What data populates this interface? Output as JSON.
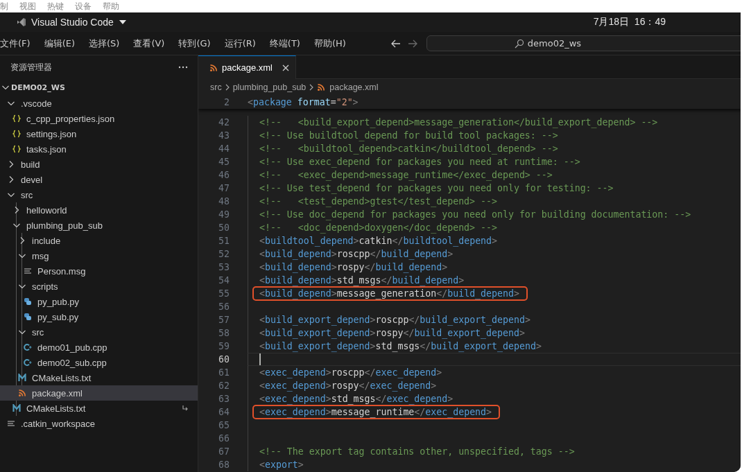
{
  "system_menu": [
    "制",
    "视图",
    "热键",
    "设备",
    "帮助"
  ],
  "title_bar": {
    "app_title": "Visual Studio Code",
    "clock": "7月18日  16：49"
  },
  "menu_bar": [
    "文件(F)",
    "编辑(E)",
    "选择(S)",
    "查看(V)",
    "转到(G)",
    "运行(R)",
    "终端(T)",
    "帮助(H)"
  ],
  "navigation": {
    "back_disabled": false,
    "forward_disabled": true
  },
  "command_center": {
    "label": "demo02_ws"
  },
  "explorer": {
    "title": "资源管理器",
    "workspace": "DEMO02_WS",
    "expanded": true,
    "items": [
      {
        "name": ".vscode",
        "kind": "folder",
        "expanded": true,
        "selected": false,
        "children": [
          {
            "name": "c_cpp_properties.json",
            "kind": "json",
            "selected": false,
            "symlink": false
          },
          {
            "name": "settings.json",
            "kind": "json",
            "selected": false,
            "symlink": false
          },
          {
            "name": "tasks.json",
            "kind": "json",
            "selected": false,
            "symlink": false
          }
        ]
      },
      {
        "name": "build",
        "kind": "folder",
        "expanded": false,
        "selected": false
      },
      {
        "name": "devel",
        "kind": "folder",
        "expanded": false,
        "selected": false
      },
      {
        "name": "src",
        "kind": "folder",
        "expanded": true,
        "selected": false,
        "children": [
          {
            "name": "helloworld",
            "kind": "folder",
            "expanded": false,
            "selected": false
          },
          {
            "name": "plumbing_pub_sub",
            "kind": "folder",
            "expanded": true,
            "selected": false,
            "children": [
              {
                "name": "include",
                "kind": "folder",
                "expanded": false,
                "selected": false
              },
              {
                "name": "msg",
                "kind": "folder",
                "expanded": true,
                "selected": false,
                "children": [
                  {
                    "name": "Person.msg",
                    "kind": "text",
                    "selected": false,
                    "symlink": false
                  }
                ]
              },
              {
                "name": "scripts",
                "kind": "folder",
                "expanded": true,
                "selected": false,
                "children": [
                  {
                    "name": "py_pub.py",
                    "kind": "python",
                    "selected": false,
                    "symlink": false
                  },
                  {
                    "name": "py_sub.py",
                    "kind": "python",
                    "selected": false,
                    "symlink": false
                  }
                ]
              },
              {
                "name": "src",
                "kind": "folder",
                "expanded": true,
                "selected": false,
                "children": [
                  {
                    "name": "demo01_pub.cpp",
                    "kind": "cpp",
                    "selected": false,
                    "symlink": false
                  },
                  {
                    "name": "demo02_sub.cpp",
                    "kind": "cpp",
                    "selected": false,
                    "symlink": false
                  }
                ]
              },
              {
                "name": "CMakeLists.txt",
                "kind": "cmake",
                "selected": false,
                "symlink": false
              },
              {
                "name": "package.xml",
                "kind": "xml",
                "selected": true,
                "symlink": false
              }
            ]
          },
          {
            "name": "CMakeLists.txt",
            "kind": "cmake",
            "selected": false,
            "symlink": true
          }
        ]
      },
      {
        "name": ".catkin_workspace",
        "kind": "text",
        "selected": false,
        "symlink": false
      }
    ]
  },
  "editor": {
    "tabs": [
      {
        "label": "package.xml",
        "kind": "xml",
        "selected": true
      }
    ],
    "breadcrumbs": [
      {
        "label": "src",
        "kind": "folder"
      },
      {
        "label": "plumbing_pub_sub",
        "kind": "folder"
      },
      {
        "label": "package.xml",
        "kind": "xml"
      }
    ],
    "sticky_line": {
      "number": "2",
      "kind": "element",
      "text": "<package format=\"2\">"
    },
    "lines": [
      {
        "number": "42",
        "kind": "comment",
        "text": "  <!--   <build_export_depend>message_generation</build_export_depend> -->",
        "highlighted": false,
        "current": false
      },
      {
        "number": "43",
        "kind": "comment",
        "text": "  <!-- Use buildtool_depend for build tool packages: -->",
        "highlighted": false,
        "current": false
      },
      {
        "number": "44",
        "kind": "comment",
        "text": "  <!--   <buildtool_depend>catkin</buildtool_depend> -->",
        "highlighted": false,
        "current": false
      },
      {
        "number": "45",
        "kind": "comment",
        "text": "  <!-- Use exec_depend for packages you need at runtime: -->",
        "highlighted": false,
        "current": false
      },
      {
        "number": "46",
        "kind": "comment",
        "text": "  <!--   <exec_depend>message_runtime</exec_depend> -->",
        "highlighted": false,
        "current": false
      },
      {
        "number": "47",
        "kind": "comment",
        "text": "  <!-- Use test_depend for packages you need only for testing: -->",
        "highlighted": false,
        "current": false
      },
      {
        "number": "48",
        "kind": "comment",
        "text": "  <!--   <test_depend>gtest</test_depend> -->",
        "highlighted": false,
        "current": false
      },
      {
        "number": "49",
        "kind": "comment",
        "text": "  <!-- Use doc_depend for packages you need only for building documentation: -->",
        "highlighted": false,
        "current": false
      },
      {
        "number": "50",
        "kind": "comment",
        "text": "  <!--   <doc_depend>doxygen</doc_depend> -->",
        "highlighted": false,
        "current": false
      },
      {
        "number": "51",
        "kind": "element",
        "text": "  <buildtool_depend>catkin</buildtool_depend>",
        "highlighted": false,
        "current": false
      },
      {
        "number": "52",
        "kind": "element",
        "text": "  <build_depend>roscpp</build_depend>",
        "highlighted": false,
        "current": false
      },
      {
        "number": "53",
        "kind": "element",
        "text": "  <build_depend>rospy</build_depend>",
        "highlighted": false,
        "current": false
      },
      {
        "number": "54",
        "kind": "element",
        "text": "  <build_depend>std_msgs</build_depend>",
        "highlighted": false,
        "current": false
      },
      {
        "number": "55",
        "kind": "element",
        "text": "  <build_depend>message_generation</build_depend>",
        "highlighted": true,
        "current": false
      },
      {
        "number": "56",
        "kind": "blank",
        "highlighted": false,
        "current": false
      },
      {
        "number": "57",
        "kind": "element",
        "text": "  <build_export_depend>roscpp</build_export_depend>",
        "highlighted": false,
        "current": false
      },
      {
        "number": "58",
        "kind": "element",
        "text": "  <build_export_depend>rospy</build_export_depend>",
        "highlighted": false,
        "current": false
      },
      {
        "number": "59",
        "kind": "element",
        "text": "  <build_export_depend>std_msgs</build_export_depend>",
        "highlighted": false,
        "current": false
      },
      {
        "number": "60",
        "kind": "blank",
        "highlighted": false,
        "current": true
      },
      {
        "number": "61",
        "kind": "element",
        "text": "  <exec_depend>roscpp</exec_depend>",
        "highlighted": false,
        "current": false
      },
      {
        "number": "62",
        "kind": "element",
        "text": "  <exec_depend>rospy</exec_depend>",
        "highlighted": false,
        "current": false
      },
      {
        "number": "63",
        "kind": "element",
        "text": "  <exec_depend>std_msgs</exec_depend>",
        "highlighted": false,
        "current": false
      },
      {
        "number": "64",
        "kind": "element",
        "text": "  <exec_depend>message_runtime</exec_depend>",
        "highlighted": true,
        "current": false
      },
      {
        "number": "65",
        "kind": "blank",
        "highlighted": false,
        "current": false
      },
      {
        "number": "66",
        "kind": "blank",
        "highlighted": false,
        "current": false
      },
      {
        "number": "67",
        "kind": "comment",
        "text": "  <!-- The export tag contains other, unspecified, tags -->",
        "highlighted": false,
        "current": false
      },
      {
        "number": "68",
        "kind": "element",
        "text": "  <export>",
        "highlighted": false,
        "current": false
      }
    ]
  }
}
